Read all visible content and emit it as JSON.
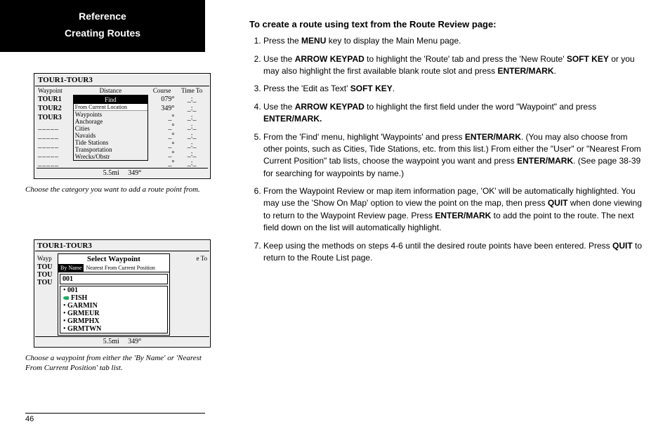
{
  "sidebar": {
    "title_line1": "Reference",
    "title_line2": "Creating Routes"
  },
  "figure_a": {
    "route_title": "TOUR1-TOUR3",
    "headers": {
      "waypoint": "Waypoint",
      "distance": "Distance",
      "course": "Course",
      "time_to": "Time To"
    },
    "tours": [
      "TOUR1",
      "TOUR2",
      "TOUR3"
    ],
    "menu_title": "Find",
    "menu_sub": "From Current Location",
    "menu_items": [
      "Waypoints",
      "Anchorage",
      "Cities",
      "Navaids",
      "Tide Stations",
      "Transportation",
      "Wrecks/Obstr"
    ],
    "course_vals": [
      "079",
      "349"
    ],
    "footer": {
      "dist": "5.5mi",
      "bearing": "349°"
    },
    "caption": "Choose the category you want to add a route point from."
  },
  "figure_b": {
    "route_title": "TOUR1-TOUR3",
    "left_head": "Wayp",
    "right_head": "e To",
    "tours_abbrev": [
      "TOU",
      "TOU",
      "TOU"
    ],
    "popup_title": "Select  Waypoint",
    "tabs": {
      "byname": "By Name",
      "nearest": "Nearest From Current Position"
    },
    "field_value": "001",
    "list": [
      "001",
      "FISH",
      "GARMIN",
      "GRMEUR",
      "GRMPHX",
      "GRMTWN"
    ],
    "footer": {
      "dist": "5.5mi",
      "bearing": "349°"
    },
    "caption": "Choose a waypoint from either the 'By Name' or 'Nearest From Current Position' tab list."
  },
  "main": {
    "heading": "To create a route using text from the Route Review page:",
    "steps": [
      {
        "pre": "Press the ",
        "b1": "MENU",
        "post": " key to display the Main Menu page."
      },
      {
        "pre": "Use the ",
        "b1": "ARROW KEYPAD",
        "mid1": " to highlight the 'Route' tab and press the 'New Route' ",
        "b2": "SOFT KEY",
        "mid2": " or you may also highlight the first available blank route slot and press ",
        "b3": "ENTER/MARK",
        "post": "."
      },
      {
        "pre": "Press the 'Edit as Text' ",
        "b1": "SOFT KEY",
        "post": "."
      },
      {
        "pre": "Use the ",
        "b1": "ARROW KEYPAD",
        "mid1": " to highlight the first field under the word \"Waypoint\" and press ",
        "b2": "ENTER/MARK.",
        "post": ""
      },
      {
        "pre": "From the 'Find' menu, highlight 'Waypoints' and press ",
        "b1": "ENTER/MARK",
        "mid1": ". (You may also choose from other points, such as Cities, Tide Stations, etc. from this list.) From either the \"User\" or \"Nearest From Current Position\" tab lists, choose the waypoint you want and press ",
        "b2": "ENTER/MARK",
        "post": ". (See page 38-39 for searching for waypoints by name.)"
      },
      {
        "pre": "From the Waypoint Review or map item information page, 'OK' will be automatically highlighted. You may use the 'Show On Map' option to view the point on the map, then press ",
        "b1": "QUIT",
        "mid1": " when done viewing to return to the Waypoint Review page. Press ",
        "b2": "ENTER/MARK",
        "post": " to add the point to the route. The next field down on the list will automatically highlight."
      },
      {
        "pre": "Keep using the methods on steps 4-6 until the desired route points have been entered. Press ",
        "b1": "QUIT",
        "post": " to return to the Route List page."
      }
    ]
  },
  "page_number": "46",
  "chart_data": {
    "type": "table",
    "figure_a_menu": [
      "Waypoints",
      "Anchorage",
      "Cities",
      "Navaids",
      "Tide Stations",
      "Transportation",
      "Wrecks/Obstr"
    ],
    "figure_a_rows": [
      {
        "waypoint": "TOUR1",
        "course": "079"
      },
      {
        "waypoint": "TOUR2",
        "course": "349"
      },
      {
        "waypoint": "TOUR3"
      }
    ],
    "figure_a_footer": {
      "distance": "5.5mi",
      "bearing": "349°"
    },
    "figure_b_waypoints": [
      "001",
      "FISH",
      "GARMIN",
      "GRMEUR",
      "GRMPHX",
      "GRMTWN"
    ],
    "figure_b_tabs": [
      "By Name",
      "Nearest From Current Position"
    ],
    "figure_b_footer": {
      "distance": "5.5mi",
      "bearing": "349°"
    }
  }
}
